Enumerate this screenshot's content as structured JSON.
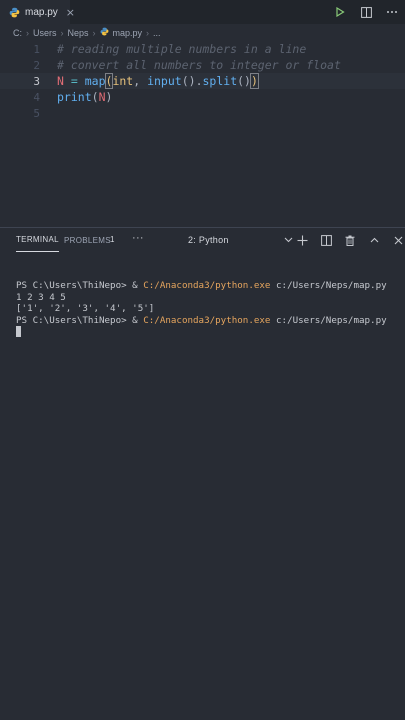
{
  "tab": {
    "label": "map.py",
    "close": "×"
  },
  "breadcrumb": {
    "items": [
      "C:",
      "Users",
      "Neps",
      "map.py",
      "..."
    ]
  },
  "editor": {
    "lines": [
      {
        "num": "1",
        "text": "# reading multiple numbers in a line"
      },
      {
        "num": "2",
        "text": "# convert all numbers to integer or float"
      },
      {
        "num": "3",
        "parts": {
          "var": "N",
          "eq": " = ",
          "fn": "map",
          "open": "(",
          "arg1": "int",
          "comma": ", ",
          "input": "input",
          "paren": "()",
          "dot": ".",
          "split": "split",
          "paren2": "()",
          "close": ")"
        }
      },
      {
        "num": "4",
        "parts": {
          "fn": "print",
          "open": "(",
          "arg": "N",
          "close": ")"
        }
      },
      {
        "num": "5",
        "text": ""
      }
    ]
  },
  "panel": {
    "tabs": {
      "terminal": "TERMINAL",
      "problems": "PROBLEMS",
      "problems_count": "1",
      "more": "···"
    },
    "select": {
      "value": "2: Python"
    }
  },
  "terminal": {
    "lines": [
      {
        "prompt": "PS C:\\Users\\ThiNepo> & ",
        "exe": "C:/Anaconda3/python.exe",
        "arg": " c:/Users/Neps/map.py"
      },
      {
        "text": "1 2 3 4 5"
      },
      {
        "text": "['1', '2', '3', '4', '5']"
      },
      {
        "prompt": "PS C:\\Users\\ThiNepo> & ",
        "exe": "C:/Anaconda3/python.exe",
        "arg": " c:/Users/Neps/map.py"
      }
    ]
  },
  "colors": {
    "accent": "#e5a55e",
    "background": "#282c34",
    "comment": "#5c6370"
  }
}
